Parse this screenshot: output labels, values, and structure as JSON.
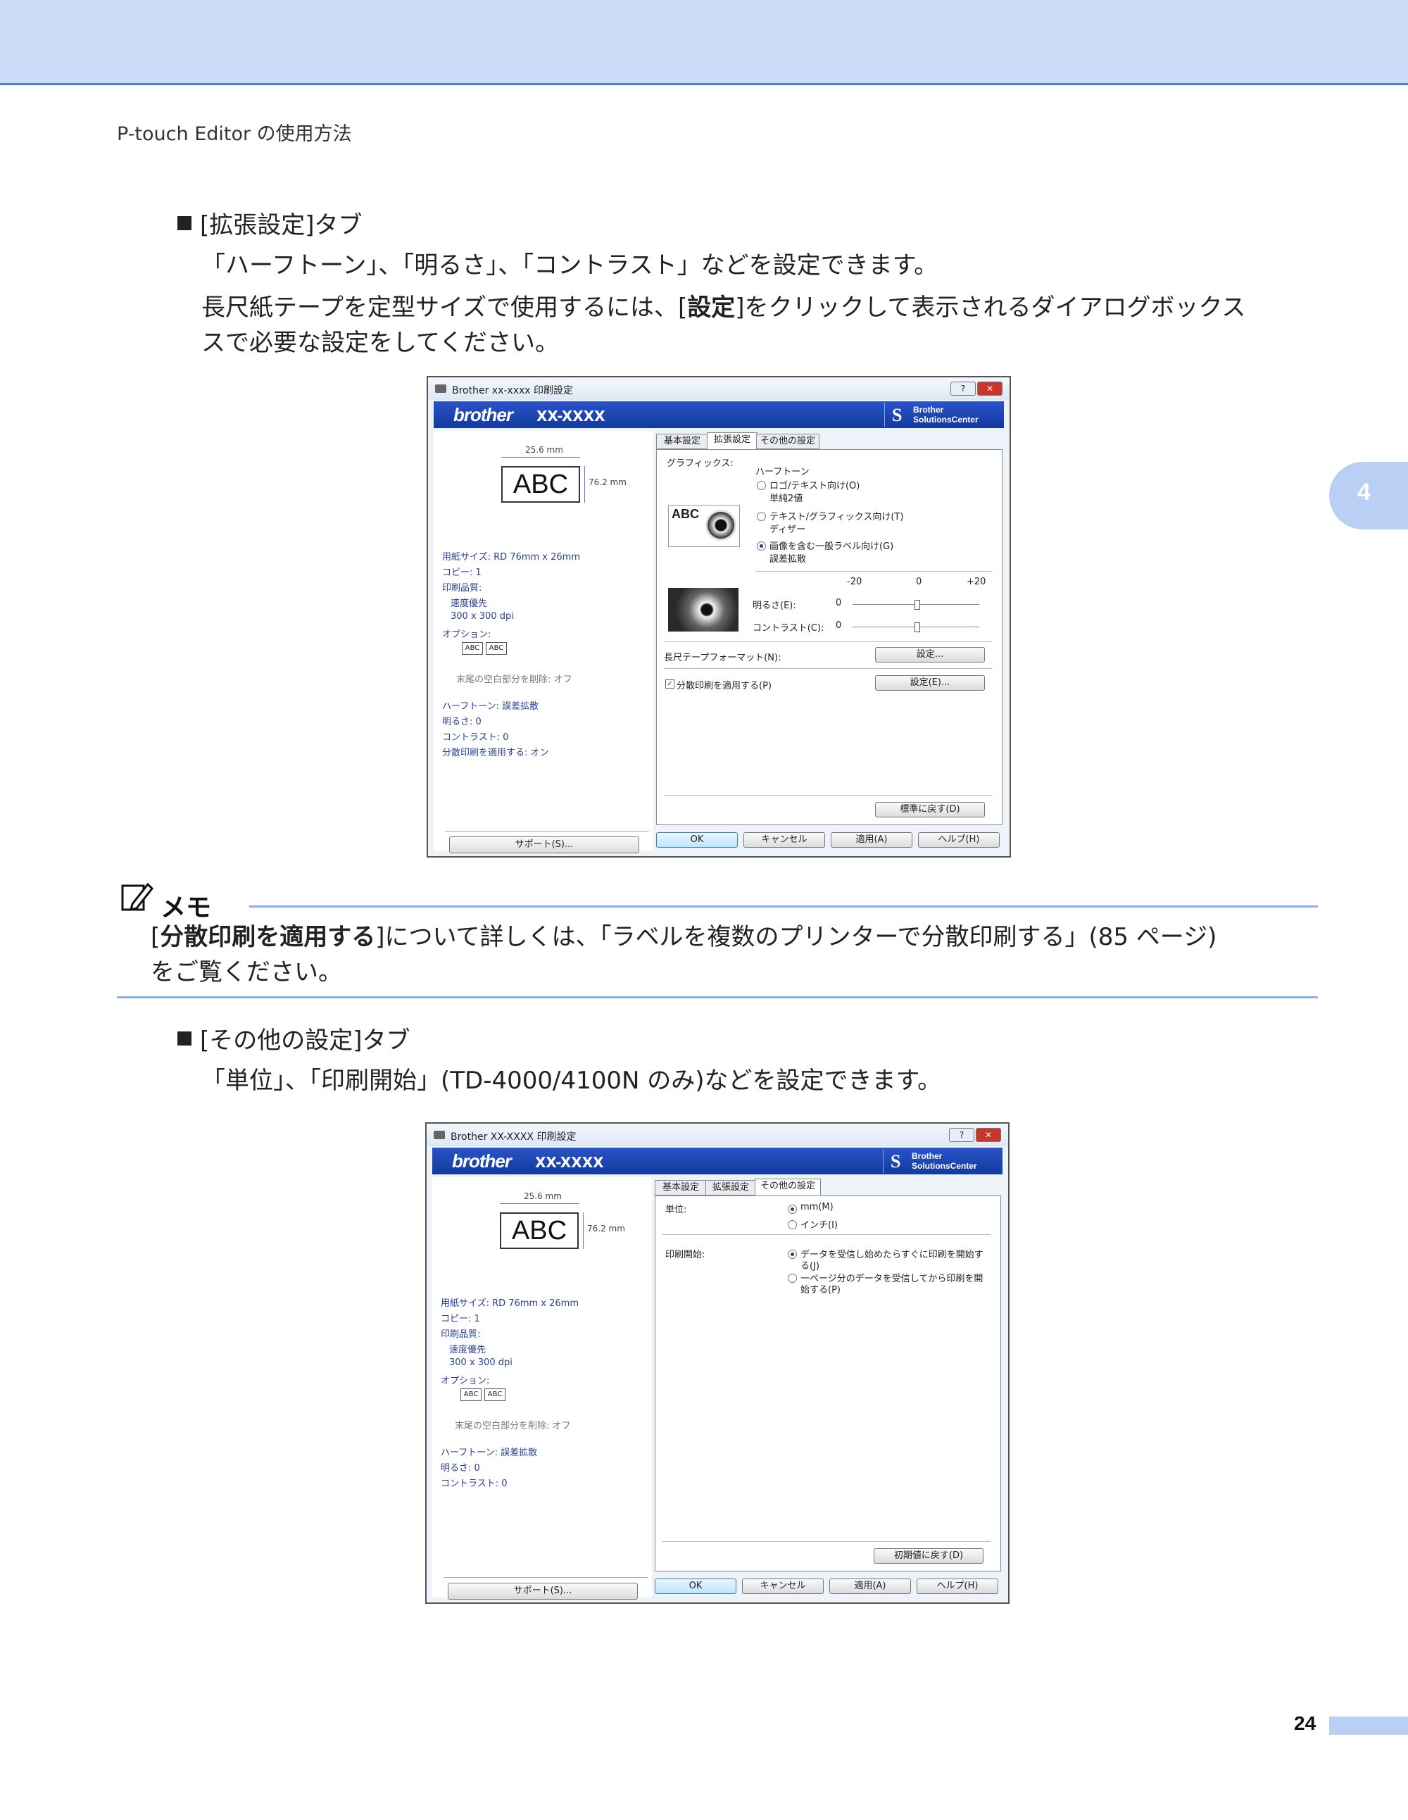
{
  "header": {
    "chapter_title": "P-touch Editor の使用方法",
    "chapter_number": "4",
    "page_number": "24"
  },
  "section_advanced": {
    "heading_prefix": "[",
    "heading_name": "拡張設定",
    "heading_suffix": "]タブ",
    "para1": "「ハーフトーン」、「明るさ」、「コントラスト」などを設定できます。",
    "para2_a": "長尺紙テープを定型サイズで使用するには、[",
    "para2_b": "設定",
    "para2_c": "]をクリックして表示されるダイアログボックス",
    "para2_d": "スで必要な設定をしてください。"
  },
  "section_other": {
    "heading_prefix": "[",
    "heading_name": "その他の設定",
    "heading_suffix": "]タブ",
    "para1_a": "「単位」、「印刷開始」(",
    "para1_b": "TD-4000/4100N",
    "para1_c": " のみ)などを設定できます。"
  },
  "memo": {
    "label": "メモ",
    "line1_a": "[",
    "line1_b": "分散印刷を適用する",
    "line1_c": "]について詳しくは、「ラベルを複数のプリンターで分散印刷する」(",
    "line1_d": "85",
    "line1_e": " ページ)",
    "line2": "をご覧ください。"
  },
  "dialog1": {
    "title": "Brother xx-xxxx 印刷設定",
    "help": "?",
    "close": "✕",
    "brand": "brother",
    "model": "XX-XXXX",
    "solutions_1": "Brother",
    "solutions_2": "SolutionsCenter",
    "width_label": "25.6 mm",
    "height_label": "76.2 mm",
    "preview_text": "ABC",
    "info": [
      "用紙サイズ: RD 76mm x 26mm",
      "コピー: 1",
      "印刷品質:",
      "速度優先",
      "300 x 300 dpi",
      "オプション:"
    ],
    "cut_info": "末尾の空白部分を削除: オフ",
    "summary": [
      "ハーフトーン: 誤差拡散",
      "明るさ: 0",
      "コントラスト: 0",
      "分散印刷を適用する: オン"
    ],
    "support": "サポート(S)...",
    "tabs": [
      "基本設定",
      "拡張設定",
      "その他の設定"
    ],
    "graphics_label": "グラフィックス:",
    "halftone_label": "ハーフトーン",
    "options": [
      {
        "label": "ロゴ/テキスト向け(O)",
        "sub": "単純2値"
      },
      {
        "label": "テキスト/グラフィックス向け(T)",
        "sub": "ディザー"
      },
      {
        "label": "画像を含む一般ラベル向け(G)",
        "sub": "誤差拡散"
      }
    ],
    "scale_min": "-20",
    "scale_mid": "0",
    "scale_max": "+20",
    "brightness_label": "明るさ(E):",
    "brightness_value": "0",
    "contrast_label": "コントラスト(C):",
    "contrast_value": "0",
    "long_format_label": "長尺テープフォーマット(N):",
    "settings_btn": "設定...",
    "distributed_label": "分散印刷を適用する(P)",
    "settings_btn2": "設定(E)...",
    "default_btn": "標準に戻す(D)",
    "ok": "OK",
    "cancel": "キャンセル",
    "apply": "適用(A)",
    "helpbtn": "ヘルプ(H)"
  },
  "dialog2": {
    "title": "Brother XX-XXXX 印刷設定",
    "help": "?",
    "close": "✕",
    "brand": "brother",
    "model": "XX-XXXX",
    "solutions_1": "Brother",
    "solutions_2": "SolutionsCenter",
    "width_label": "25.6 mm",
    "height_label": "76.2 mm",
    "preview_text": "ABC",
    "info": [
      "用紙サイズ: RD 76mm x 26mm",
      "コピー: 1",
      "印刷品質:",
      "速度優先",
      "300 x 300 dpi",
      "オプション:"
    ],
    "cut_info": "末尾の空白部分を削除: オフ",
    "summary": [
      "ハーフトーン: 誤差拡散",
      "明るさ: 0",
      "コントラスト: 0"
    ],
    "support": "サポート(S)...",
    "tabs": [
      "基本設定",
      "拡張設定",
      "その他の設定"
    ],
    "unit_label": "単位:",
    "unit_mm": "mm(M)",
    "unit_inch": "インチ(I)",
    "print_start_label": "印刷開始:",
    "ps_opt1_a": "データを受信し始めたらすぐに印刷を開始す",
    "ps_opt1_b": "る(J)",
    "ps_opt2_a": "一ページ分のデータを受信してから印刷を開",
    "ps_opt2_b": "始する(P)",
    "default_btn": "初期値に戻す(D)",
    "ok": "OK",
    "cancel": "キャンセル",
    "apply": "適用(A)",
    "helpbtn": "ヘルプ(H)"
  }
}
